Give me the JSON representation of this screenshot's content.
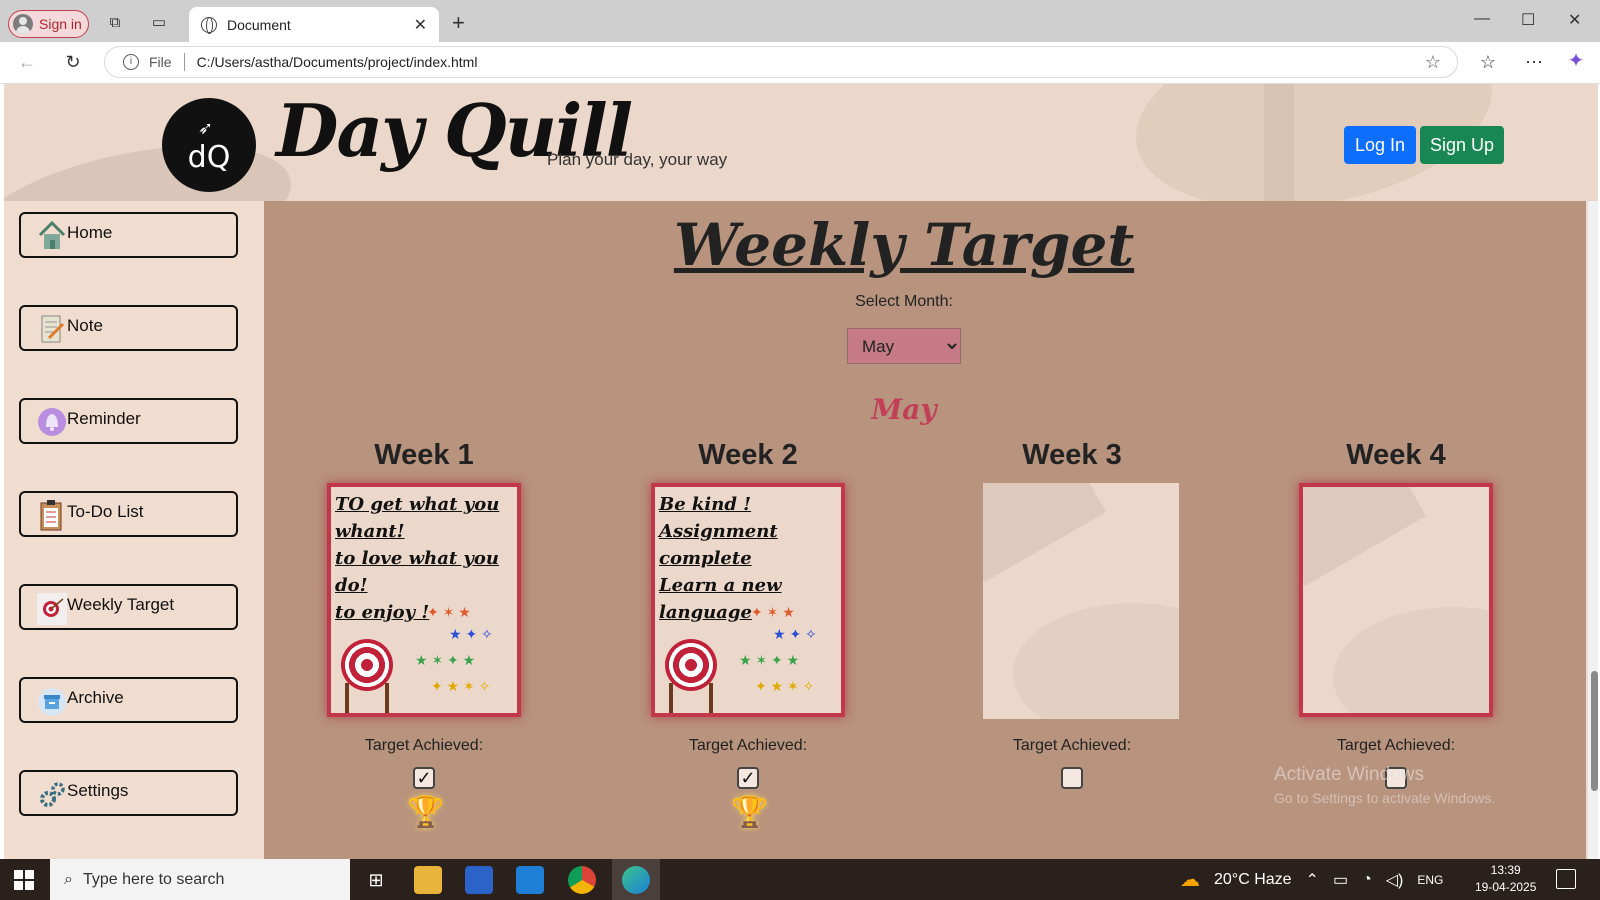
{
  "browser": {
    "signin_label": "Sign in",
    "tab_title": "Document",
    "url_scheme": "File",
    "url": "C:/Users/astha/Documents/project/index.html"
  },
  "header": {
    "logo_text": "dQ",
    "brand": "Day Quill",
    "tagline": "Plan your day, your way",
    "login_label": "Log In",
    "signup_label": "Sign Up"
  },
  "sidebar": {
    "items": [
      {
        "label": "Home",
        "icon": "home-icon"
      },
      {
        "label": "Note",
        "icon": "notepad-icon"
      },
      {
        "label": "Reminder",
        "icon": "bell-icon"
      },
      {
        "label": "To-Do List",
        "icon": "checklist-icon"
      },
      {
        "label": "Weekly Target",
        "icon": "target-icon"
      },
      {
        "label": "Archive",
        "icon": "archive-icon"
      },
      {
        "label": "Settings",
        "icon": "gear-icon"
      }
    ]
  },
  "main": {
    "title": "Weekly Target",
    "select_label": "Select Month:",
    "selected_month": "May",
    "month_heading": "May",
    "achieved_label": "Target Achieved:",
    "weeks": [
      {
        "name": "Week 1",
        "lines": [
          "TO get what you whant!",
          "to love what you do!",
          "to enjoy !"
        ],
        "achieved": true
      },
      {
        "name": "Week 2",
        "lines": [
          "Be kind !",
          "Assignment complete",
          "Learn a new language"
        ],
        "achieved": true
      },
      {
        "name": "Week 3",
        "lines": [],
        "achieved": false
      },
      {
        "name": "Week 4",
        "lines": [],
        "achieved": false
      }
    ]
  },
  "watermark": {
    "line1": "Activate Windows",
    "line2": "Go to Settings to activate Windows."
  },
  "taskbar": {
    "search_placeholder": "Type here to search",
    "weather": "20°C  Haze",
    "lang": "ENG",
    "time": "13:39",
    "date": "19-04-2025"
  }
}
